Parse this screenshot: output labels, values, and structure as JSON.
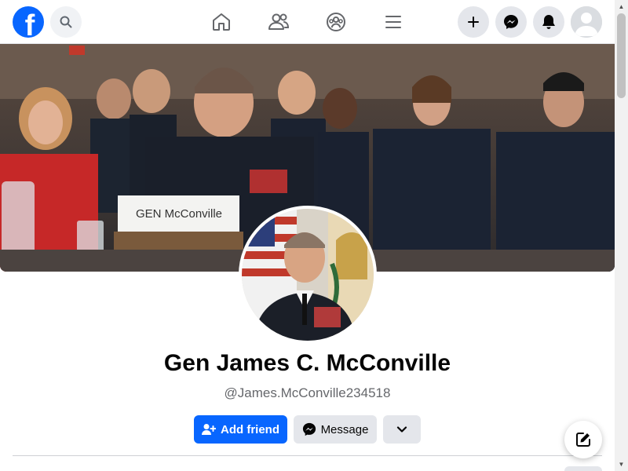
{
  "brand": {
    "logo_letter": "f",
    "accent": "#0866ff"
  },
  "topbar": {
    "icons": [
      "search-icon",
      "home-icon",
      "friends-icon",
      "groups-icon",
      "menu-icon",
      "plus-icon",
      "messenger-icon",
      "bell-icon",
      "avatar-icon"
    ]
  },
  "cover": {
    "nameplate": "GEN McConville"
  },
  "profile": {
    "name": "Gen James C. McConville",
    "handle": "@James.McConville234518"
  },
  "actions": {
    "add_friend_label": "Add friend",
    "message_label": "Message",
    "more_icon": "chevron-down-icon"
  },
  "floating": {
    "compose_icon": "compose-icon"
  }
}
